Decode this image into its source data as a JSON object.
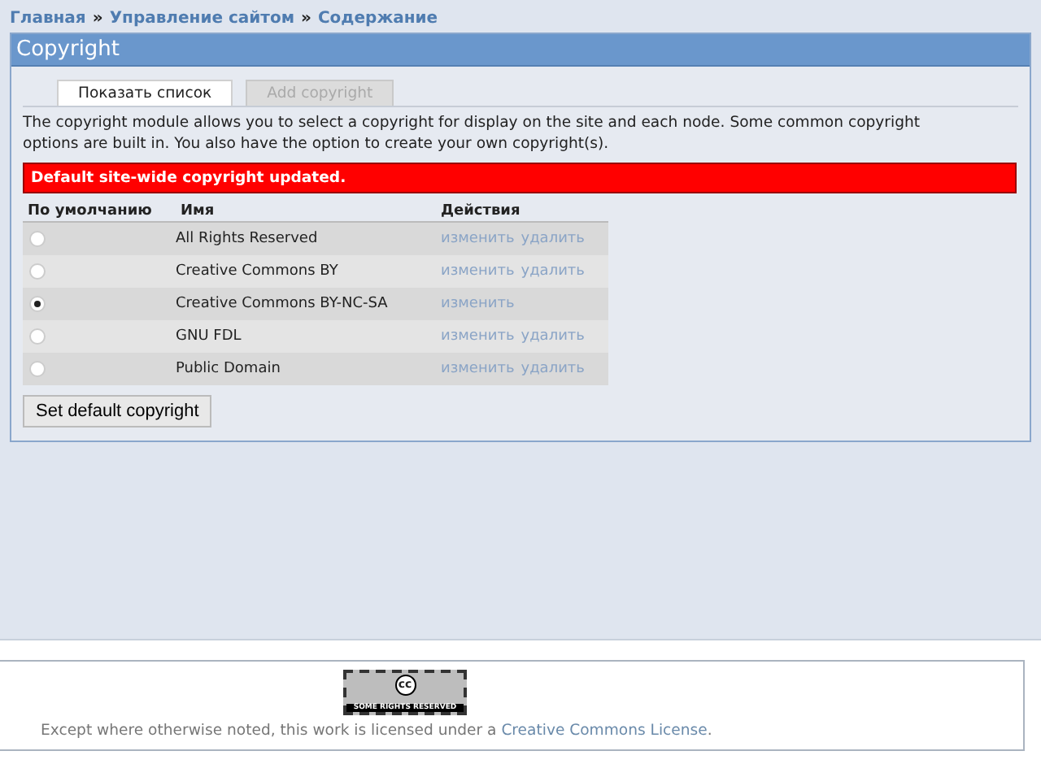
{
  "breadcrumb": [
    {
      "label": "Главная"
    },
    {
      "label": "Управление сайтом"
    },
    {
      "label": "Содержание"
    }
  ],
  "breadcrumb_separator": "»",
  "panel": {
    "title": "Copyright",
    "tabs": [
      {
        "label": "Показать список",
        "selected": true
      },
      {
        "label": "Add copyright",
        "selected": false
      }
    ],
    "description": "The copyright module allows you to select a copyright for display on the site and each node. Some common copyright options are built in. You also have the option to create your own copyright(s).",
    "message": "Default site-wide copyright updated.",
    "table": {
      "columns": [
        "По умолчанию",
        "Имя",
        "Действия"
      ],
      "rows": [
        {
          "selected": false,
          "name": "All Rights Reserved",
          "actions": [
            "изменить",
            "удалить"
          ]
        },
        {
          "selected": false,
          "name": "Creative Commons BY",
          "actions": [
            "изменить",
            "удалить"
          ]
        },
        {
          "selected": true,
          "name": "Creative Commons BY-NC-SA",
          "actions": [
            "изменить"
          ]
        },
        {
          "selected": false,
          "name": "GNU FDL",
          "actions": [
            "изменить",
            "удалить"
          ]
        },
        {
          "selected": false,
          "name": "Public Domain",
          "actions": [
            "изменить",
            "удалить"
          ]
        }
      ]
    },
    "button": "Set default copyright"
  },
  "footer": {
    "badge": {
      "symbol": "cc",
      "text": "SOME RIGHTS RESERVED"
    },
    "text_before": "Except where otherwise noted, this work is licensed under a ",
    "link": "Creative Commons License",
    "text_after": "."
  }
}
